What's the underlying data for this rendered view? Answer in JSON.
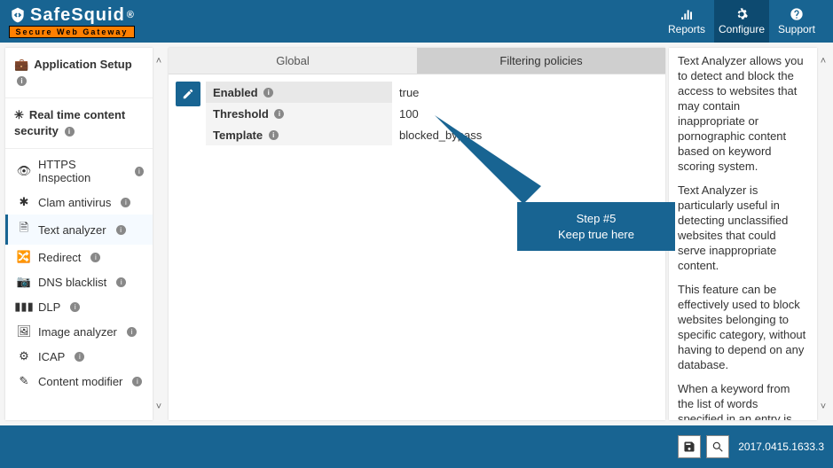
{
  "header": {
    "brand_main": "SafeSquid",
    "brand_reg": "®",
    "brand_sub": "Secure Web Gateway",
    "actions": [
      {
        "label": "Reports"
      },
      {
        "label": "Configure"
      },
      {
        "label": "Support"
      }
    ]
  },
  "sidebar": {
    "group1": "Application Setup",
    "group2": "Real time content security",
    "items": [
      {
        "label": "HTTPS Inspection"
      },
      {
        "label": "Clam antivirus"
      },
      {
        "label": "Text analyzer"
      },
      {
        "label": "Redirect"
      },
      {
        "label": "DNS blacklist"
      },
      {
        "label": "DLP"
      },
      {
        "label": "Image analyzer"
      },
      {
        "label": "ICAP"
      },
      {
        "label": "Content modifier"
      }
    ]
  },
  "tabs": {
    "global": "Global",
    "filtering": "Filtering policies"
  },
  "form": {
    "enabled_label": "Enabled",
    "enabled_value": "true",
    "threshold_label": "Threshold",
    "threshold_value": "100",
    "template_label": "Template",
    "template_value": "blocked_bypass"
  },
  "help": {
    "p1": "Text Analyzer allows you to detect and block the access to websites that may contain inappropriate or pornographic content based on keyword scoring system.",
    "p2": "Text Analyzer is particularly useful in detecting unclassified websites that could serve inappropriate content.",
    "p3": "This feature can be effectively used to block websites belonging to specific category, without having to depend on any database.",
    "p4": "When a keyword from the list of words specified in an entry is found, the page is given the score"
  },
  "callout": {
    "line1": "Step #5",
    "line2": "Keep true here"
  },
  "footer": {
    "version": "2017.0415.1633.3"
  }
}
